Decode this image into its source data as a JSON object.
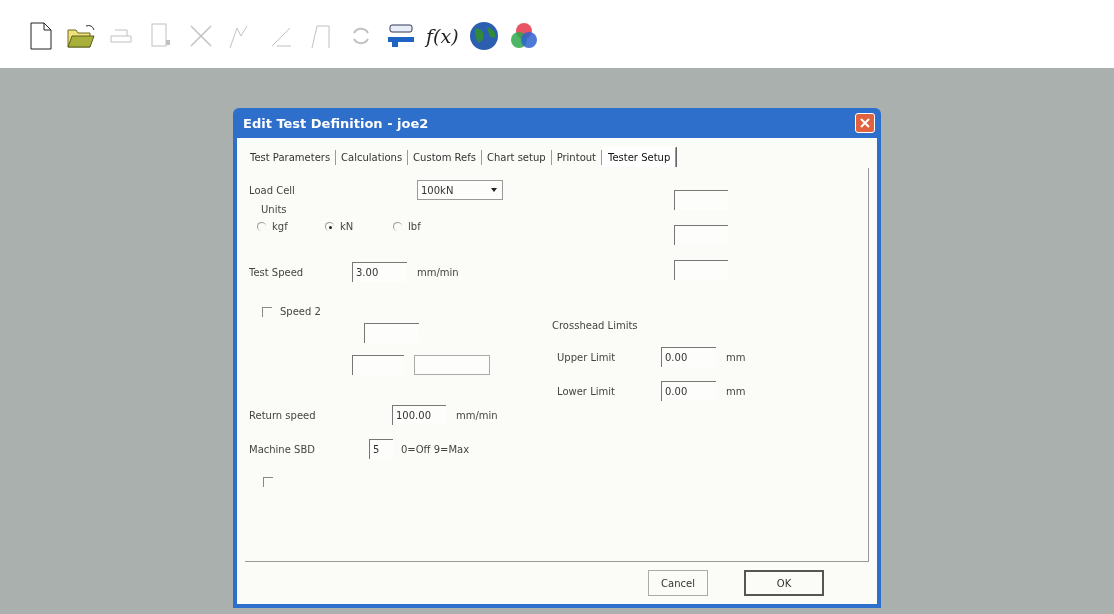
{
  "toolbar": [
    {
      "kind": "icon",
      "disabled": false
    },
    {
      "kind": "icon",
      "disabled": false
    },
    {
      "kind": "icon",
      "disabled": true
    },
    {
      "kind": "icon",
      "disabled": true
    },
    {
      "kind": "icon",
      "disabled": true
    },
    {
      "kind": "icon",
      "disabled": true
    },
    {
      "kind": "icon",
      "disabled": true
    },
    {
      "kind": "icon",
      "disabled": true
    },
    {
      "kind": "icon",
      "disabled": true
    },
    {
      "kind": "icon",
      "disabled": false
    },
    {
      "kind": "text",
      "disabled": false,
      "label": "f(x)"
    },
    {
      "kind": "icon",
      "disabled": false
    },
    {
      "kind": "icon",
      "disabled": false
    }
  ],
  "dialog": {
    "title": "Edit Test Definition - joe2",
    "tabs": [
      {
        "label": "Test Parameters",
        "selected": false
      },
      {
        "label": "Calculations",
        "selected": false
      },
      {
        "label": "Custom Refs",
        "selected": false
      },
      {
        "label": "Chart setup",
        "selected": false
      },
      {
        "label": "Printout",
        "selected": false
      },
      {
        "label": "Tester Setup",
        "selected": true
      }
    ],
    "load_cell": {
      "label": "Load Cell",
      "value": "100kN"
    },
    "units": {
      "label": "Units",
      "options": [
        {
          "label": "kgf",
          "selected": false
        },
        {
          "label": "kN",
          "selected": true
        },
        {
          "label": "lbf",
          "selected": false
        }
      ]
    },
    "test_speed": {
      "label": "Test Speed",
      "value": "3.00",
      "unit": "mm/min"
    },
    "speed2": {
      "label": "Speed 2",
      "checked": false
    },
    "return_speed": {
      "label": "Return speed",
      "value": "100.00",
      "unit": "mm/min"
    },
    "machine_sbd": {
      "label": "Machine SBD",
      "value": "5",
      "hint": "0=Off 9=Max"
    },
    "extra_checkbox": {
      "checked": false
    },
    "crosshead": {
      "title": "Crosshead Limits",
      "limits": [
        {
          "label": "Upper Limit",
          "value": "0.00",
          "unit": "mm"
        },
        {
          "label": "Lower Limit",
          "value": "0.00",
          "unit": "mm"
        }
      ]
    },
    "buttons": [
      {
        "label": "Cancel",
        "default": false
      },
      {
        "label": "OK",
        "default": true
      }
    ]
  }
}
